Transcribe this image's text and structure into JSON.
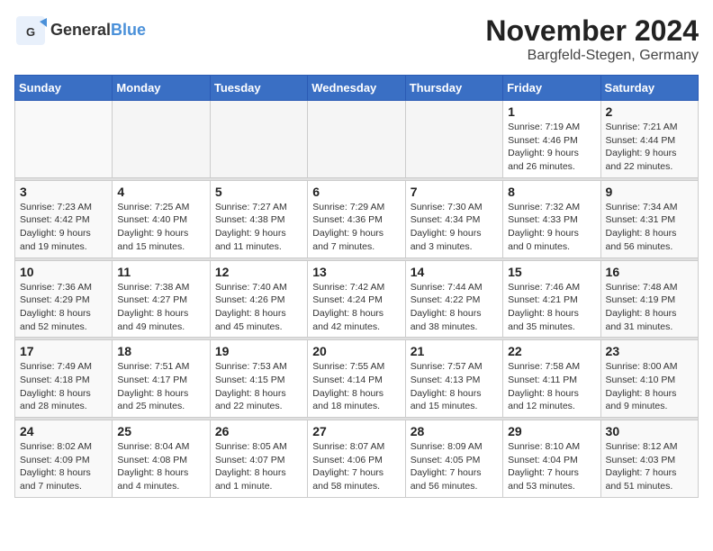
{
  "header": {
    "logo_general": "General",
    "logo_blue": "Blue",
    "month_title": "November 2024",
    "location": "Bargfeld-Stegen, Germany"
  },
  "weekdays": [
    "Sunday",
    "Monday",
    "Tuesday",
    "Wednesday",
    "Thursday",
    "Friday",
    "Saturday"
  ],
  "weeks": [
    [
      {
        "day": "",
        "info": ""
      },
      {
        "day": "",
        "info": ""
      },
      {
        "day": "",
        "info": ""
      },
      {
        "day": "",
        "info": ""
      },
      {
        "day": "",
        "info": ""
      },
      {
        "day": "1",
        "info": "Sunrise: 7:19 AM\nSunset: 4:46 PM\nDaylight: 9 hours and 26 minutes."
      },
      {
        "day": "2",
        "info": "Sunrise: 7:21 AM\nSunset: 4:44 PM\nDaylight: 9 hours and 22 minutes."
      }
    ],
    [
      {
        "day": "3",
        "info": "Sunrise: 7:23 AM\nSunset: 4:42 PM\nDaylight: 9 hours and 19 minutes."
      },
      {
        "day": "4",
        "info": "Sunrise: 7:25 AM\nSunset: 4:40 PM\nDaylight: 9 hours and 15 minutes."
      },
      {
        "day": "5",
        "info": "Sunrise: 7:27 AM\nSunset: 4:38 PM\nDaylight: 9 hours and 11 minutes."
      },
      {
        "day": "6",
        "info": "Sunrise: 7:29 AM\nSunset: 4:36 PM\nDaylight: 9 hours and 7 minutes."
      },
      {
        "day": "7",
        "info": "Sunrise: 7:30 AM\nSunset: 4:34 PM\nDaylight: 9 hours and 3 minutes."
      },
      {
        "day": "8",
        "info": "Sunrise: 7:32 AM\nSunset: 4:33 PM\nDaylight: 9 hours and 0 minutes."
      },
      {
        "day": "9",
        "info": "Sunrise: 7:34 AM\nSunset: 4:31 PM\nDaylight: 8 hours and 56 minutes."
      }
    ],
    [
      {
        "day": "10",
        "info": "Sunrise: 7:36 AM\nSunset: 4:29 PM\nDaylight: 8 hours and 52 minutes."
      },
      {
        "day": "11",
        "info": "Sunrise: 7:38 AM\nSunset: 4:27 PM\nDaylight: 8 hours and 49 minutes."
      },
      {
        "day": "12",
        "info": "Sunrise: 7:40 AM\nSunset: 4:26 PM\nDaylight: 8 hours and 45 minutes."
      },
      {
        "day": "13",
        "info": "Sunrise: 7:42 AM\nSunset: 4:24 PM\nDaylight: 8 hours and 42 minutes."
      },
      {
        "day": "14",
        "info": "Sunrise: 7:44 AM\nSunset: 4:22 PM\nDaylight: 8 hours and 38 minutes."
      },
      {
        "day": "15",
        "info": "Sunrise: 7:46 AM\nSunset: 4:21 PM\nDaylight: 8 hours and 35 minutes."
      },
      {
        "day": "16",
        "info": "Sunrise: 7:48 AM\nSunset: 4:19 PM\nDaylight: 8 hours and 31 minutes."
      }
    ],
    [
      {
        "day": "17",
        "info": "Sunrise: 7:49 AM\nSunset: 4:18 PM\nDaylight: 8 hours and 28 minutes."
      },
      {
        "day": "18",
        "info": "Sunrise: 7:51 AM\nSunset: 4:17 PM\nDaylight: 8 hours and 25 minutes."
      },
      {
        "day": "19",
        "info": "Sunrise: 7:53 AM\nSunset: 4:15 PM\nDaylight: 8 hours and 22 minutes."
      },
      {
        "day": "20",
        "info": "Sunrise: 7:55 AM\nSunset: 4:14 PM\nDaylight: 8 hours and 18 minutes."
      },
      {
        "day": "21",
        "info": "Sunrise: 7:57 AM\nSunset: 4:13 PM\nDaylight: 8 hours and 15 minutes."
      },
      {
        "day": "22",
        "info": "Sunrise: 7:58 AM\nSunset: 4:11 PM\nDaylight: 8 hours and 12 minutes."
      },
      {
        "day": "23",
        "info": "Sunrise: 8:00 AM\nSunset: 4:10 PM\nDaylight: 8 hours and 9 minutes."
      }
    ],
    [
      {
        "day": "24",
        "info": "Sunrise: 8:02 AM\nSunset: 4:09 PM\nDaylight: 8 hours and 7 minutes."
      },
      {
        "day": "25",
        "info": "Sunrise: 8:04 AM\nSunset: 4:08 PM\nDaylight: 8 hours and 4 minutes."
      },
      {
        "day": "26",
        "info": "Sunrise: 8:05 AM\nSunset: 4:07 PM\nDaylight: 8 hours and 1 minute."
      },
      {
        "day": "27",
        "info": "Sunrise: 8:07 AM\nSunset: 4:06 PM\nDaylight: 7 hours and 58 minutes."
      },
      {
        "day": "28",
        "info": "Sunrise: 8:09 AM\nSunset: 4:05 PM\nDaylight: 7 hours and 56 minutes."
      },
      {
        "day": "29",
        "info": "Sunrise: 8:10 AM\nSunset: 4:04 PM\nDaylight: 7 hours and 53 minutes."
      },
      {
        "day": "30",
        "info": "Sunrise: 8:12 AM\nSunset: 4:03 PM\nDaylight: 7 hours and 51 minutes."
      }
    ]
  ]
}
